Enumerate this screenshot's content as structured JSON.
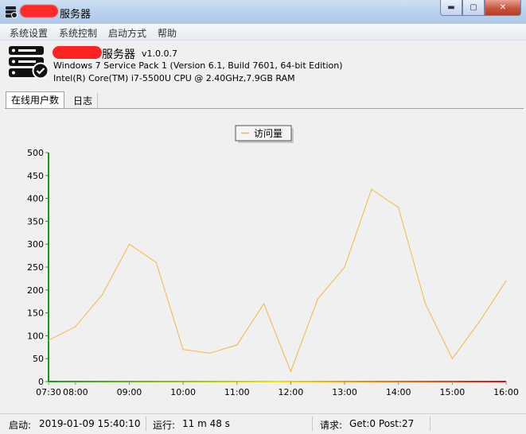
{
  "window": {
    "title": "服务器"
  },
  "menu": [
    "系统设置",
    "系统控制",
    "启动方式",
    "帮助"
  ],
  "header": {
    "app_name": "服务器",
    "version": "v1.0.0.7",
    "os": "Windows 7 Service Pack 1 (Version 6.1, Build 7601, 64-bit Edition)",
    "cpu": "Intel(R) Core(TM) i7-5500U CPU @ 2.40GHz,7.9GB RAM"
  },
  "tabs": [
    {
      "label": "在线用户数",
      "active": true
    },
    {
      "label": "日志",
      "active": false
    }
  ],
  "chart_data": {
    "type": "line",
    "x": [
      "07:30",
      "08:00",
      "08:30",
      "09:00",
      "09:30",
      "10:00",
      "10:30",
      "11:00",
      "11:30",
      "12:00",
      "12:30",
      "13:00",
      "13:30",
      "14:00",
      "14:30",
      "15:00",
      "15:30",
      "16:00"
    ],
    "x_ticks": [
      "07:30",
      "08:00",
      "09:00",
      "10:00",
      "11:00",
      "12:00",
      "13:00",
      "14:00",
      "15:00",
      "16:00"
    ],
    "series": [
      {
        "name": "访问量",
        "values": [
          90,
          120,
          190,
          300,
          260,
          70,
          62,
          80,
          170,
          22,
          180,
          250,
          420,
          380,
          170,
          50,
          130,
          220
        ],
        "color": "#f5b642"
      }
    ],
    "ylim": [
      0,
      500
    ],
    "y_ticks": [
      0,
      50,
      100,
      150,
      200,
      250,
      300,
      350,
      400,
      450,
      500
    ],
    "legend": "top-center",
    "grid": false
  },
  "status": {
    "start_label": "启动:",
    "start_value": "2019-01-09 15:40:10",
    "run_label": "运行:",
    "run_value": "11 m 48 s",
    "req_label": "请求:",
    "req_value": "Get:0 Post:27"
  }
}
